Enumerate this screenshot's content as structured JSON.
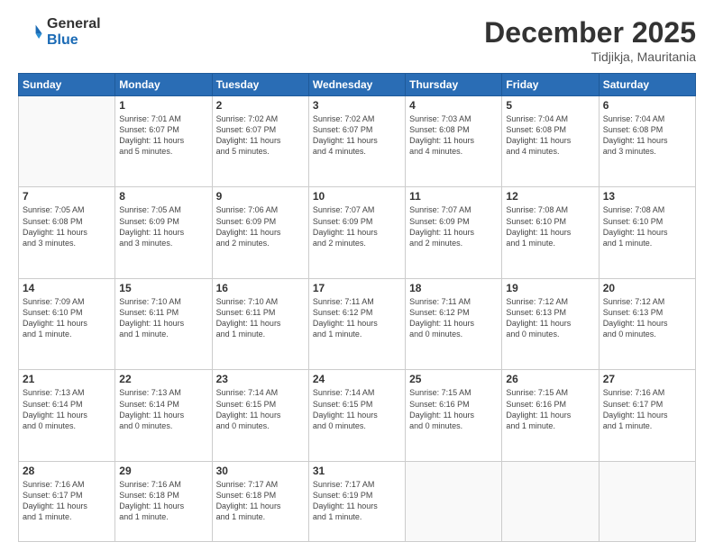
{
  "header": {
    "logo_general": "General",
    "logo_blue": "Blue",
    "month_title": "December 2025",
    "location": "Tidjikja, Mauritania"
  },
  "days_of_week": [
    "Sunday",
    "Monday",
    "Tuesday",
    "Wednesday",
    "Thursday",
    "Friday",
    "Saturday"
  ],
  "weeks": [
    [
      {
        "day": "",
        "info": ""
      },
      {
        "day": "1",
        "info": "Sunrise: 7:01 AM\nSunset: 6:07 PM\nDaylight: 11 hours\nand 5 minutes."
      },
      {
        "day": "2",
        "info": "Sunrise: 7:02 AM\nSunset: 6:07 PM\nDaylight: 11 hours\nand 5 minutes."
      },
      {
        "day": "3",
        "info": "Sunrise: 7:02 AM\nSunset: 6:07 PM\nDaylight: 11 hours\nand 4 minutes."
      },
      {
        "day": "4",
        "info": "Sunrise: 7:03 AM\nSunset: 6:08 PM\nDaylight: 11 hours\nand 4 minutes."
      },
      {
        "day": "5",
        "info": "Sunrise: 7:04 AM\nSunset: 6:08 PM\nDaylight: 11 hours\nand 4 minutes."
      },
      {
        "day": "6",
        "info": "Sunrise: 7:04 AM\nSunset: 6:08 PM\nDaylight: 11 hours\nand 3 minutes."
      }
    ],
    [
      {
        "day": "7",
        "info": "Sunrise: 7:05 AM\nSunset: 6:08 PM\nDaylight: 11 hours\nand 3 minutes."
      },
      {
        "day": "8",
        "info": "Sunrise: 7:05 AM\nSunset: 6:09 PM\nDaylight: 11 hours\nand 3 minutes."
      },
      {
        "day": "9",
        "info": "Sunrise: 7:06 AM\nSunset: 6:09 PM\nDaylight: 11 hours\nand 2 minutes."
      },
      {
        "day": "10",
        "info": "Sunrise: 7:07 AM\nSunset: 6:09 PM\nDaylight: 11 hours\nand 2 minutes."
      },
      {
        "day": "11",
        "info": "Sunrise: 7:07 AM\nSunset: 6:09 PM\nDaylight: 11 hours\nand 2 minutes."
      },
      {
        "day": "12",
        "info": "Sunrise: 7:08 AM\nSunset: 6:10 PM\nDaylight: 11 hours\nand 1 minute."
      },
      {
        "day": "13",
        "info": "Sunrise: 7:08 AM\nSunset: 6:10 PM\nDaylight: 11 hours\nand 1 minute."
      }
    ],
    [
      {
        "day": "14",
        "info": "Sunrise: 7:09 AM\nSunset: 6:10 PM\nDaylight: 11 hours\nand 1 minute."
      },
      {
        "day": "15",
        "info": "Sunrise: 7:10 AM\nSunset: 6:11 PM\nDaylight: 11 hours\nand 1 minute."
      },
      {
        "day": "16",
        "info": "Sunrise: 7:10 AM\nSunset: 6:11 PM\nDaylight: 11 hours\nand 1 minute."
      },
      {
        "day": "17",
        "info": "Sunrise: 7:11 AM\nSunset: 6:12 PM\nDaylight: 11 hours\nand 1 minute."
      },
      {
        "day": "18",
        "info": "Sunrise: 7:11 AM\nSunset: 6:12 PM\nDaylight: 11 hours\nand 0 minutes."
      },
      {
        "day": "19",
        "info": "Sunrise: 7:12 AM\nSunset: 6:13 PM\nDaylight: 11 hours\nand 0 minutes."
      },
      {
        "day": "20",
        "info": "Sunrise: 7:12 AM\nSunset: 6:13 PM\nDaylight: 11 hours\nand 0 minutes."
      }
    ],
    [
      {
        "day": "21",
        "info": "Sunrise: 7:13 AM\nSunset: 6:14 PM\nDaylight: 11 hours\nand 0 minutes."
      },
      {
        "day": "22",
        "info": "Sunrise: 7:13 AM\nSunset: 6:14 PM\nDaylight: 11 hours\nand 0 minutes."
      },
      {
        "day": "23",
        "info": "Sunrise: 7:14 AM\nSunset: 6:15 PM\nDaylight: 11 hours\nand 0 minutes."
      },
      {
        "day": "24",
        "info": "Sunrise: 7:14 AM\nSunset: 6:15 PM\nDaylight: 11 hours\nand 0 minutes."
      },
      {
        "day": "25",
        "info": "Sunrise: 7:15 AM\nSunset: 6:16 PM\nDaylight: 11 hours\nand 0 minutes."
      },
      {
        "day": "26",
        "info": "Sunrise: 7:15 AM\nSunset: 6:16 PM\nDaylight: 11 hours\nand 1 minute."
      },
      {
        "day": "27",
        "info": "Sunrise: 7:16 AM\nSunset: 6:17 PM\nDaylight: 11 hours\nand 1 minute."
      }
    ],
    [
      {
        "day": "28",
        "info": "Sunrise: 7:16 AM\nSunset: 6:17 PM\nDaylight: 11 hours\nand 1 minute."
      },
      {
        "day": "29",
        "info": "Sunrise: 7:16 AM\nSunset: 6:18 PM\nDaylight: 11 hours\nand 1 minute."
      },
      {
        "day": "30",
        "info": "Sunrise: 7:17 AM\nSunset: 6:18 PM\nDaylight: 11 hours\nand 1 minute."
      },
      {
        "day": "31",
        "info": "Sunrise: 7:17 AM\nSunset: 6:19 PM\nDaylight: 11 hours\nand 1 minute."
      },
      {
        "day": "",
        "info": ""
      },
      {
        "day": "",
        "info": ""
      },
      {
        "day": "",
        "info": ""
      }
    ]
  ]
}
